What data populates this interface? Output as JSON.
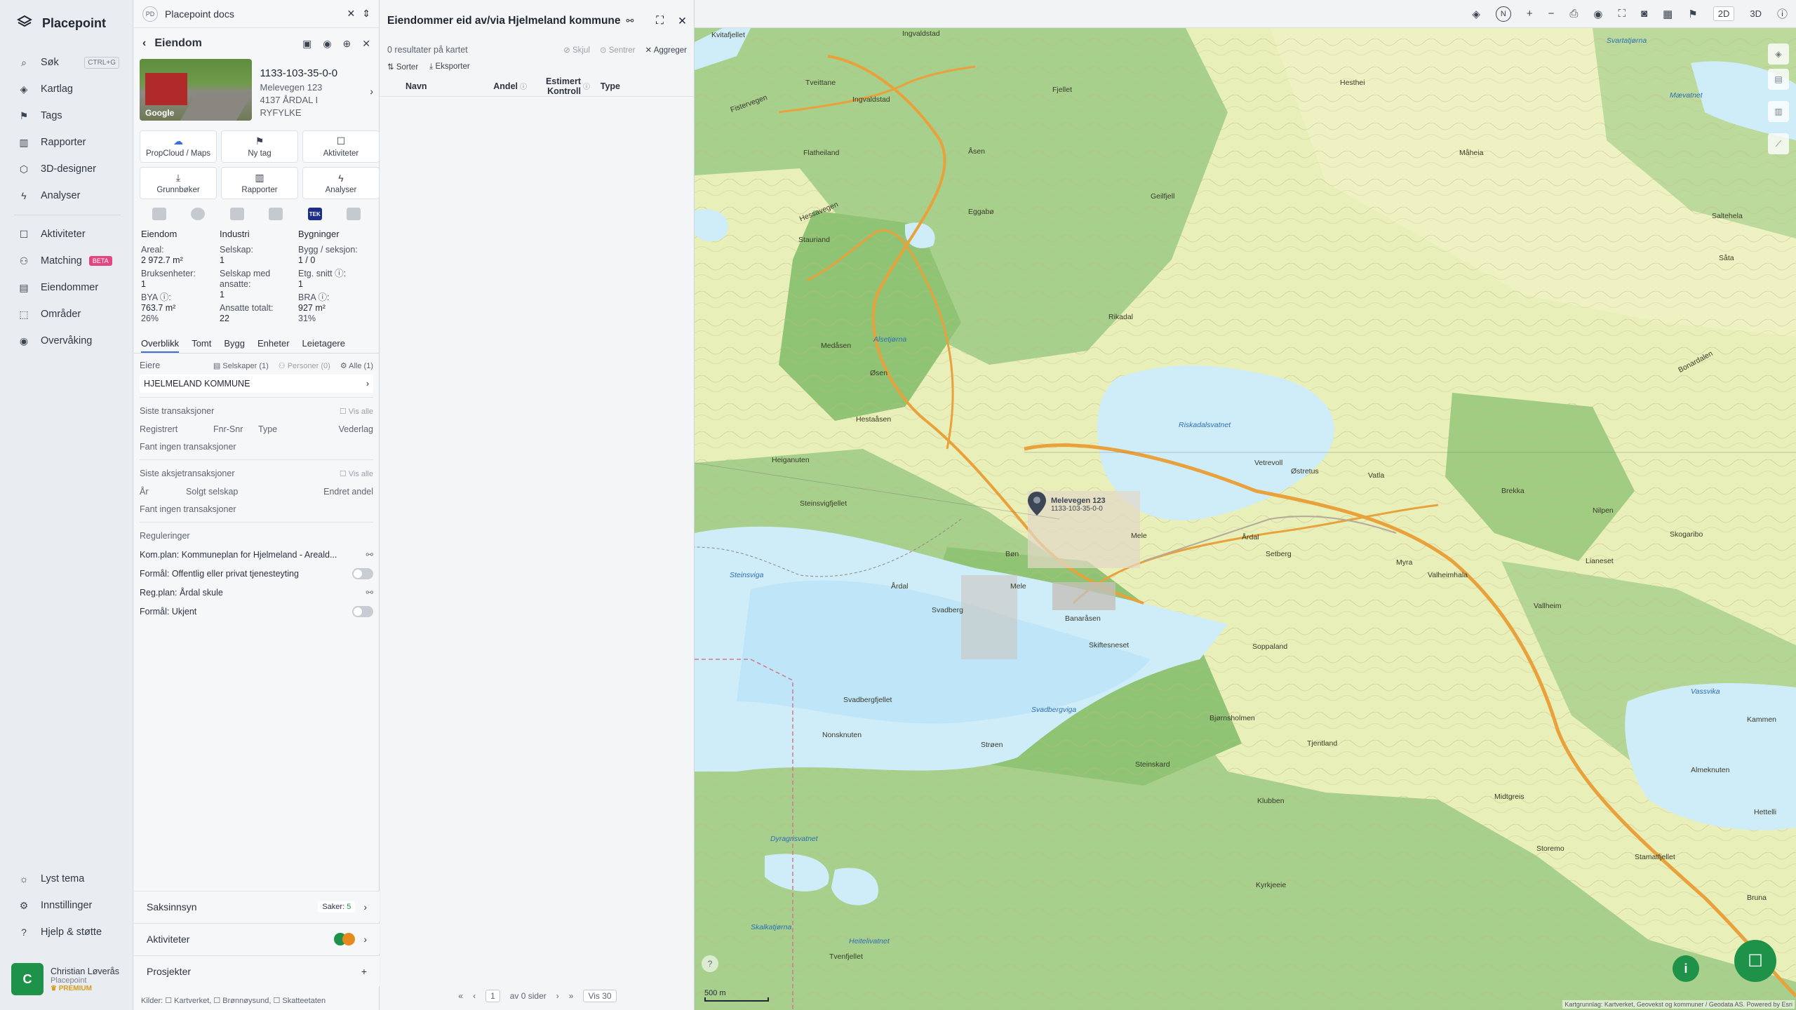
{
  "app": {
    "name": "Placepoint"
  },
  "nav": {
    "items": [
      {
        "label": "Søk",
        "shortcut": "CTRL+G"
      },
      {
        "label": "Kartlag"
      },
      {
        "label": "Tags"
      },
      {
        "label": "Rapporter"
      },
      {
        "label": "3D-designer"
      },
      {
        "label": "Analyser"
      },
      {
        "label": "Aktiviteter"
      },
      {
        "label": "Matching",
        "badge": "BETA"
      },
      {
        "label": "Eiendommer"
      },
      {
        "label": "Områder"
      },
      {
        "label": "Overvåking"
      }
    ],
    "bottom": [
      {
        "label": "Lyst tema"
      },
      {
        "label": "Innstillinger"
      },
      {
        "label": "Hjelp & støtte"
      }
    ],
    "user": {
      "initial": "C",
      "name": "Christian Løverås",
      "org": "Placepoint",
      "tier": "PREMIUM"
    }
  },
  "doc": {
    "badge": "PD",
    "title": "Placepoint docs"
  },
  "eiendom": {
    "title": "Eiendom",
    "photo_label": "Google",
    "id": "1133-103-35-0-0",
    "address": "Melevegen 123",
    "postal": "4137 ÅRDAL I RYFYLKE",
    "buttons": [
      "PropCloud / Maps",
      "Ny tag",
      "Aktiviteter",
      "Grunnbøker",
      "Rapporter",
      "Analyser"
    ],
    "tek": "TEK",
    "stats": {
      "col1": {
        "head": "Eiendom",
        "l1": "Areal:",
        "v1": "2 972.7 m²",
        "l2": "Bruksenheter:",
        "v2": "1",
        "l3": "BYA ⓘ:",
        "v3": "763.7 m²",
        "v3b": "26%"
      },
      "col2": {
        "head": "Industri",
        "l1": "Selskap:",
        "v1": "1",
        "l2": "Selskap med ansatte:",
        "v2": "1",
        "l3": "Ansatte totalt:",
        "v3": "22"
      },
      "col3": {
        "head": "Bygninger",
        "l1": "Bygg / seksjon:",
        "v1": "1 / 0",
        "l2": "Etg. snitt ⓘ:",
        "v2": "1",
        "l3": "BRA ⓘ:",
        "v3": "927 m²",
        "v3b": "31%"
      }
    },
    "tabs": [
      "Overblikk",
      "Tomt",
      "Bygg",
      "Enheter",
      "Leietagere"
    ],
    "owners": {
      "label": "Eiere",
      "selskaper": "Selskaper (1)",
      "personer": "Personer (0)",
      "alle": "Alle (1)",
      "owner": "HJELMELAND KOMMUNE"
    },
    "trans": {
      "label": "Siste transaksjoner",
      "visalle": "Vis alle",
      "cols": [
        "Registrert",
        "Fnr-Snr",
        "Type",
        "Vederlag"
      ],
      "empty": "Fant ingen transaksjoner"
    },
    "aksje": {
      "label": "Siste aksjetransaksjoner",
      "visalle": "Vis alle",
      "cols": [
        "År",
        "Solgt selskap",
        "Endret andel"
      ],
      "empty": "Fant ingen transaksjoner"
    },
    "reg": {
      "label": "Reguleringer",
      "rows": [
        "Kom.plan: Kommuneplan for Hjelmeland - Areald...",
        "Formål: Offentlig eller privat tjenesteyting",
        "Reg.plan: Årdal skule",
        "Formål: Ukjent"
      ]
    },
    "saksinnsyn": {
      "label": "Saksinnsyn",
      "count_label": "Saker:",
      "count": "5"
    },
    "aktiviteter": {
      "label": "Aktiviteter"
    },
    "prosjekter": {
      "label": "Prosjekter"
    },
    "kilder": "Kilder: ☐ Kartverket, ☐ Brønnøysund, ☐ Skatteetaten"
  },
  "list": {
    "title": "Eiendommer eid av/via Hjelmeland kommune",
    "results": "0 resultater på kartet",
    "skjul": "Skjul",
    "sentrer": "Sentrer",
    "aggreger": "Aggreger",
    "sorter": "Sorter",
    "eksporter": "Eksporter",
    "cols": [
      "Navn",
      "Andel",
      "Estimert Kontroll",
      "Type"
    ],
    "pager": {
      "page": "1",
      "of": "av 0 sider",
      "show": "Vis 30"
    }
  },
  "map": {
    "toolbar": {
      "dim2d": "2D",
      "dim3d": "3D",
      "north": "N"
    },
    "pin_label": "Melevegen 123",
    "pin_sub": "1133-103-35-0-0",
    "scale": "500 m",
    "attribution": "Kartgrunnlag: Kartverket, Geovekst og kommuner / Geodata AS. Powered by Esri",
    "places": [
      "Kvitafjellet",
      "Tveittane",
      "Ingvaldstad",
      "Ingvaldstad",
      "Fistervegen",
      "Fjellet",
      "Hesthei",
      "Mævatnet",
      "Flatheiland",
      "Åsen",
      "Måheia",
      "Eggabø",
      "Hessavegen",
      "Geilfjell",
      "Saltehela",
      "Stauriand",
      "Såta",
      "Rikadal",
      "Medåsen",
      "Øsen",
      "Bonardalen",
      "Hestaåsen",
      "Nilpen",
      "Heiganuten",
      "Skogaribo",
      "Vetrevoll",
      "Østretus",
      "Vatla",
      "Brekka",
      "Steinsvigfjellet",
      "Årdal",
      "Mele",
      "Bøn",
      "Setberg",
      "Myra",
      "Valheimhala",
      "Lianeset",
      "Årdal",
      "Mele",
      "Svadberg",
      "Banaråsen",
      "Vallheim",
      "Skiftesneset",
      "Soppaland",
      "Svadbergfjellet",
      "Bjørnsholmen",
      "Kammen",
      "Tjentland",
      "Nonsknuten",
      "Strøen",
      "Steinskard",
      "Klubben",
      "Almeknuten",
      "Hettelli",
      "Midtgreis",
      "Storemo",
      "Kyrkjeeie",
      "Stamatfjellet",
      "Bruna",
      "Tvenfjellet"
    ],
    "waters": [
      "Svartatjørna",
      "Riskadalsvatnet",
      "Steinsviga",
      "Svadbergviga",
      "Vassvika",
      "Dyragrisvatnet",
      "Skalkatjørna",
      "Heitelivatnet",
      "Alsetjørna"
    ]
  }
}
